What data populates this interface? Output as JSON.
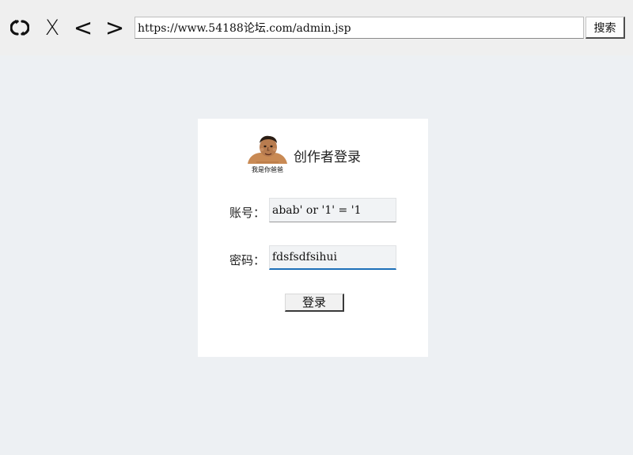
{
  "toolbar": {
    "url": "https://www.54188论坛.com/admin.jsp",
    "stop_glyph": "X",
    "back_glyph": "<",
    "forward_glyph": ">",
    "search_label": "搜索",
    "icons": [
      "refresh-icon",
      "stop-icon",
      "back-icon",
      "forward-icon"
    ]
  },
  "login": {
    "logo_caption": "我是你爸爸",
    "title": "创作者登录",
    "account_label": "账号：",
    "account_value": "abab' or '1' = '1",
    "password_label": "密码：",
    "password_value": "fdsfsdfsihui",
    "submit_label": "登录"
  },
  "colors": {
    "page_background": "#edf0f3",
    "toolbar_background": "#efefef",
    "card_background": "#ffffff",
    "focus_underline": "#1d6fb8"
  }
}
